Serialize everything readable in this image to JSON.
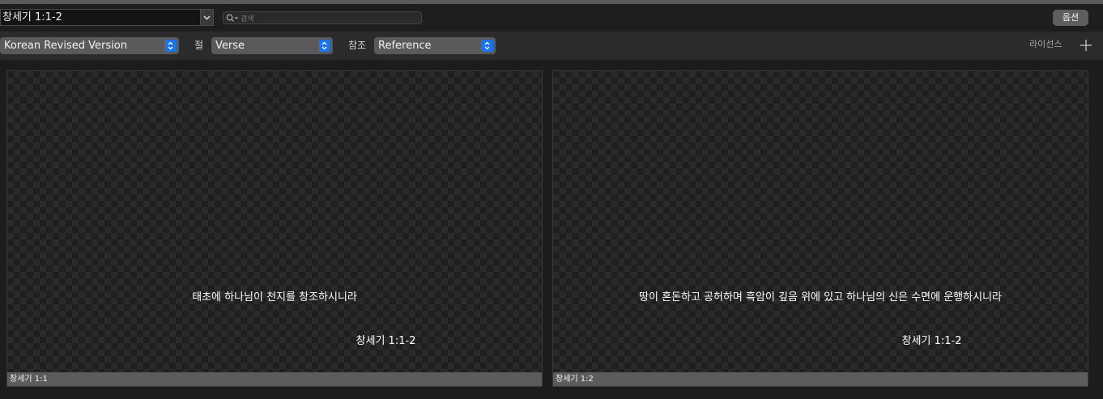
{
  "toolbar": {
    "reference_value": "창세기 1:1-2",
    "search_placeholder": "검색",
    "options_label": "옵션"
  },
  "settings": {
    "version_selected": "Korean Revised Version",
    "verse_label": "절",
    "verse_selected": "Verse",
    "reference_label": "참조",
    "reference_selected": "Reference",
    "license_label": "라이선스"
  },
  "slides": [
    {
      "verse_text": "태초에 하나님이 천지를 창조하시니라",
      "citation": "창세기 1:1-2",
      "caption": "창세기 1:1"
    },
    {
      "verse_text": "땅이 혼돈하고 공허하며 흑암이 깊음 위에 있고 하나님의 신은 수면에 운행하시니라",
      "citation": "창세기 1:1-2",
      "caption": "창세기 1:2"
    }
  ],
  "colors": {
    "accent": "#1a73e8"
  }
}
